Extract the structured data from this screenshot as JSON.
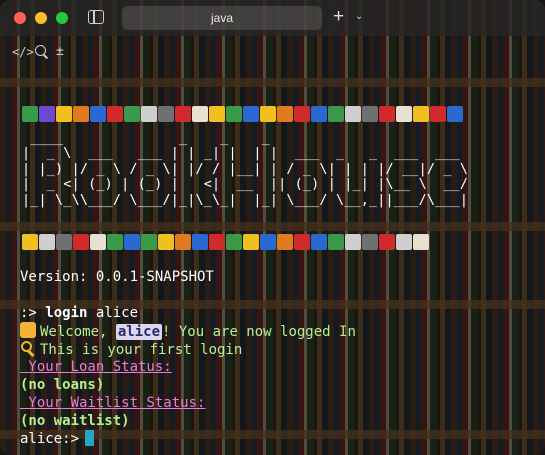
{
  "window": {
    "tab_title": "java",
    "new_tab_label": "+",
    "tab_menu_label": "⌄"
  },
  "toolbar": {
    "code_label": "</>",
    "split_label": "±"
  },
  "banner": {
    "ascii_art": " ____              _    _    _\n|  _ \\  ___   ___ | | _| |  | |  ___  _   _  ___  ___\n| |_) |/ _ \\ / _ \\| |/ / |__| | / _ \\| | | |/ __|/ _ \\\n|  _ <| (_) | (_) |   <|  __  || (_) | |_| |\\__ \\  __/\n|_| \\_\\\\___/ \\___/|_|\\_\\_|  |_| \\___/ \\__,_||___/\\___|",
    "top_icons": [
      "#3a9a4a",
      "#6a4bd0",
      "#f0c020",
      "#e07a20",
      "#2a6ad0",
      "#d02a2a",
      "#3a9a4a",
      "#cfcfcf",
      "#707070",
      "#d02a2a",
      "#e8e0d0",
      "#f0c020",
      "#3a9a4a",
      "#2a6ad0",
      "#f0c020",
      "#e07a20",
      "#d02a2a",
      "#2a6ad0",
      "#3a9a4a",
      "#cfcfcf",
      "#707070",
      "#d02a2a",
      "#e8e0d0",
      "#f0c020",
      "#d02a2a",
      "#2a6ad0"
    ],
    "bottom_icons": [
      "#f0c020",
      "#cfcfcf",
      "#707070",
      "#d02a2a",
      "#e8e0d0",
      "#3a9a4a",
      "#2a6ad0",
      "#3a9a4a",
      "#f0c020",
      "#e07a20",
      "#2a6ad0",
      "#d02a2a",
      "#3a9a4a",
      "#f0c020",
      "#2a6ad0",
      "#e07a20",
      "#d02a2a",
      "#2a6ad0",
      "#3a9a4a",
      "#cfcfcf",
      "#707070",
      "#d02a2a",
      "#cfcfcf",
      "#e8e0d0"
    ]
  },
  "terminal": {
    "version": "Version: 0.0.1-SNAPSHOT",
    "command_prompt": ":> ",
    "command_verb": "login",
    "command_arg": " alice",
    "welcome_pre": "Welcome, ",
    "welcome_user": "alice",
    "welcome_post": "! You are now logged In",
    "first_login": "This is your first login",
    "loan_header": " Your Loan Status:",
    "loan_value": "(no loans)",
    "waitlist_header": " Your Waitlist Status:",
    "waitlist_value": "(no waitlist)",
    "prompt": "alice:>"
  }
}
